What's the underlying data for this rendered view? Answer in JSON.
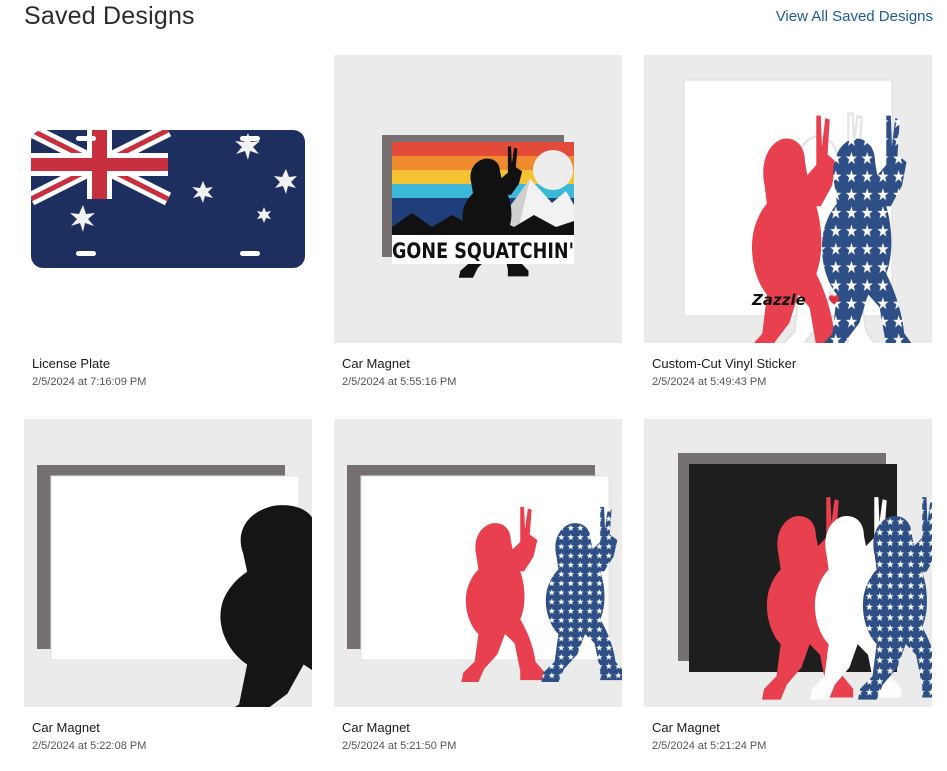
{
  "header": {
    "title": "Saved Designs",
    "view_all_label": "View All Saved Designs"
  },
  "designs": [
    {
      "name": "License Plate",
      "date": "2/5/2024 at 7:16:09 PM",
      "artwork": "australia-flag-license-plate"
    },
    {
      "name": "Car Magnet",
      "date": "2/5/2024 at 5:55:16 PM",
      "artwork": "gone-squatchin-car-magnet",
      "art_text": "GONE SQUATCHIN'"
    },
    {
      "name": "Custom-Cut Vinyl Sticker",
      "date": "2/5/2024 at 5:49:43 PM",
      "artwork": "bigfoot-trio-sticker",
      "brand_text": "Zazzle"
    },
    {
      "name": "Car Magnet",
      "date": "2/5/2024 at 5:22:08 PM",
      "artwork": "black-bigfoot-peace-car-magnet"
    },
    {
      "name": "Car Magnet",
      "date": "2/5/2024 at 5:21:50 PM",
      "artwork": "red-blue-bigfoot-car-magnet"
    },
    {
      "name": "Car Magnet",
      "date": "2/5/2024 at 5:21:24 PM",
      "artwork": "red-white-blue-bigfoot-black-car-magnet"
    }
  ],
  "colors": {
    "link": "#1f5a99",
    "thumb_background": "#ebebeb",
    "flag_blue": "#1d2f5e",
    "bigfoot_red": "#e8404f",
    "bigfoot_blue": "#2e4f86"
  }
}
